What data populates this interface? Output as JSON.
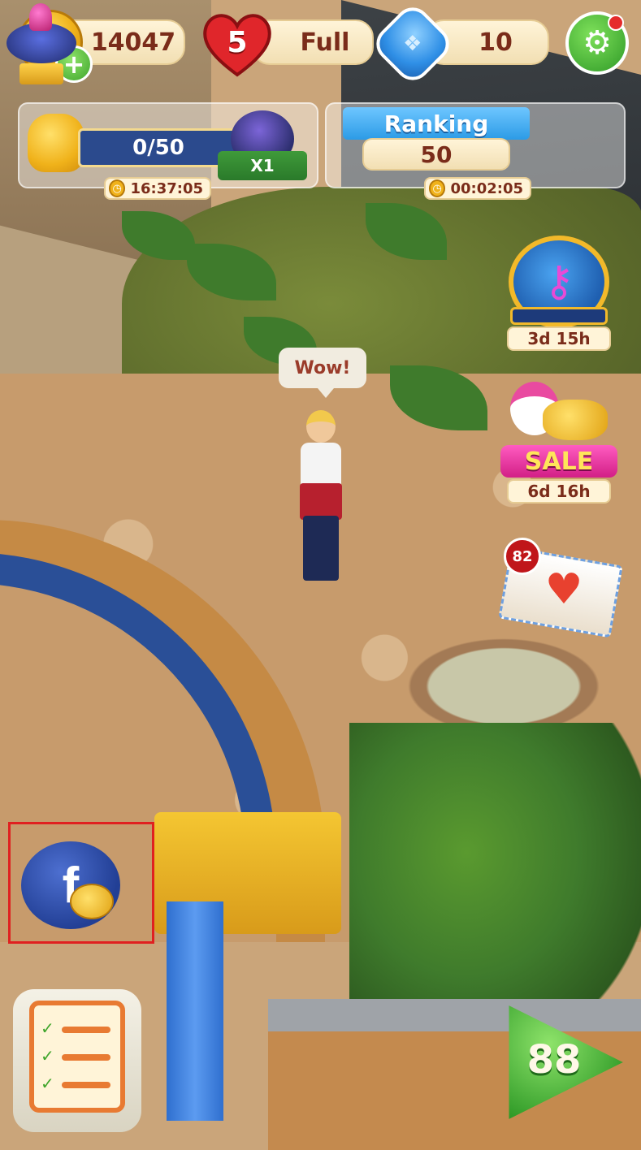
{
  "hud": {
    "coins": "14047",
    "lives_count": "5",
    "lives_status": "Full",
    "boosters": "10"
  },
  "event": {
    "progress_text": "0/50",
    "progress_fraction": 0,
    "reward_multiplier": "X1",
    "timer": "16:37:05"
  },
  "ranking": {
    "title": "Ranking",
    "value": "50",
    "timer": "00:02:05"
  },
  "side_events": {
    "key_timer": "3d 15h",
    "sale_label": "SALE",
    "sale_timer": "6d 16h",
    "mail_count": "82"
  },
  "scene": {
    "speech": "Wow!"
  },
  "play": {
    "level": "88"
  },
  "colors": {
    "accent_green": "#2f9a27",
    "pill_text": "#7a2c1a",
    "highlight_red": "#e02020"
  },
  "icons": {
    "coin": "coin-icon",
    "plus": "plus-icon",
    "heart": "heart-icon",
    "fish": "fish-booster-icon",
    "settings": "gear-icon",
    "bell": "bell-icon",
    "trophy": "spinning-top-trophy-icon",
    "key": "key-icon",
    "mail": "mail-icon",
    "facebook": "facebook-icon",
    "tasks": "clipboard-tasks-icon",
    "play": "play-arrow-icon"
  }
}
